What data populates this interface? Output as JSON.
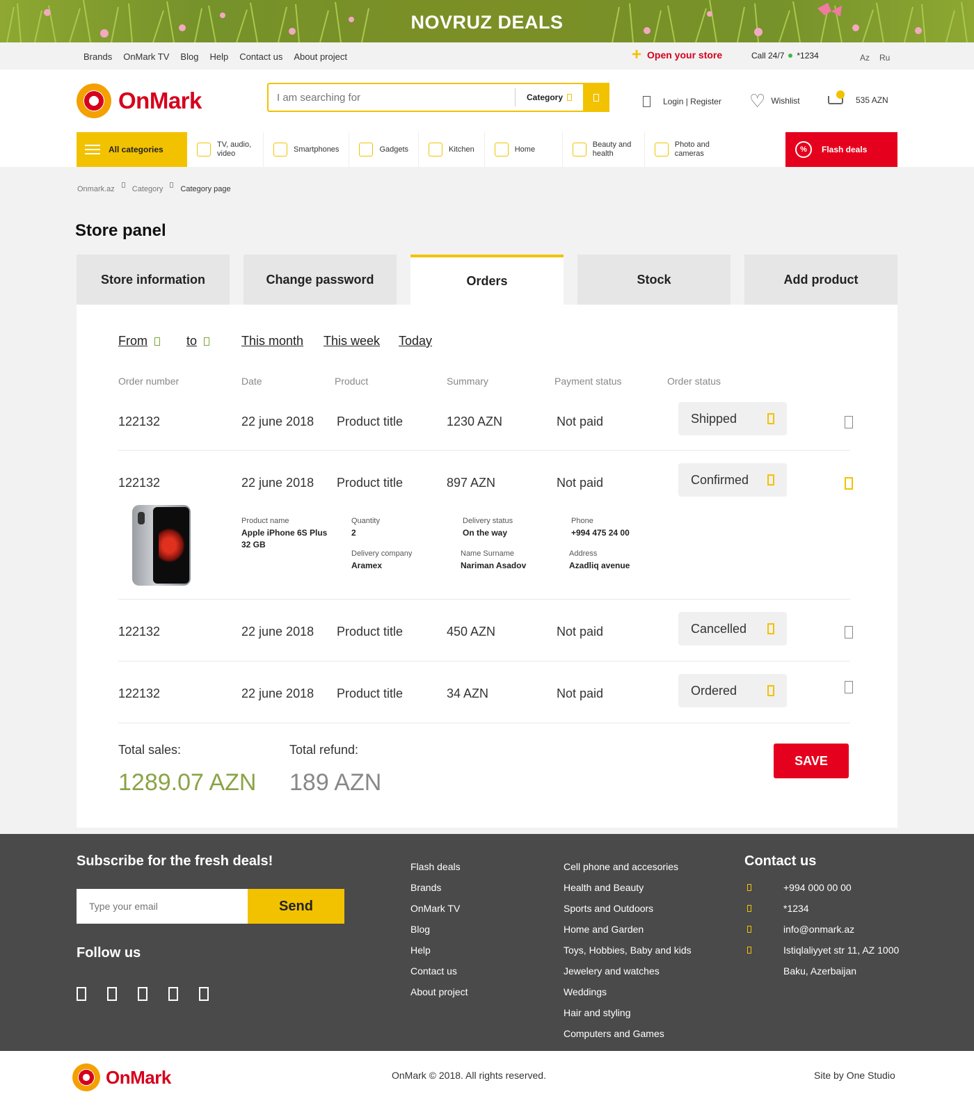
{
  "banner": {
    "title": "NOVRUZ DEALS"
  },
  "topbar": {
    "links": [
      "Brands",
      "OnMark TV",
      "Blog",
      "Help",
      "Contact us",
      "About project"
    ],
    "open_store": "Open your store",
    "call_label": "Call 24/7",
    "call_number": "*1234",
    "languages": [
      "Az",
      "Ru"
    ]
  },
  "header": {
    "logo": "OnMark",
    "search_placeholder": "I am searching for",
    "category_label": "Category",
    "login": "Login | Register",
    "wishlist": "Wishlist",
    "cart_total": "535 AZN"
  },
  "nav": {
    "all_categories": "All categories",
    "items": [
      "TV, audio, video",
      "Smartphones",
      "Gadgets",
      "Kitchen",
      "Home",
      "Beauty and health",
      "Photo and cameras"
    ],
    "flash_deals": "Flash deals",
    "flash_icon_text": "%"
  },
  "breadcrumb": [
    "Onmark.az",
    "Category",
    "Category page"
  ],
  "page_title": "Store panel",
  "tabs": [
    "Store information",
    "Change password",
    "Orders",
    "Stock",
    "Add product"
  ],
  "active_tab": "Orders",
  "filters": {
    "from": "From",
    "to": "to",
    "month": "This month",
    "week": "This week",
    "today": "Today"
  },
  "table": {
    "headers": [
      "Order number",
      "Date",
      "Product",
      "Summary",
      "Payment status",
      "Order status"
    ],
    "rows": [
      {
        "number": "122132",
        "date": "22 june 2018",
        "product": "Product title",
        "summary": "1230 AZN",
        "payment": "Not paid",
        "status": "Shipped",
        "expanded": false
      },
      {
        "number": "122132",
        "date": "22 june 2018",
        "product": "Product title",
        "summary": "897 AZN",
        "payment": "Not paid",
        "status": "Confirmed",
        "expanded": true
      },
      {
        "number": "122132",
        "date": "22 june 2018",
        "product": "Product title",
        "summary": "450 AZN",
        "payment": "Not paid",
        "status": "Cancelled",
        "expanded": false
      },
      {
        "number": "122132",
        "date": "22 june 2018",
        "product": "Product title",
        "summary": "34 AZN",
        "payment": "Not paid",
        "status": "Ordered",
        "expanded": false
      }
    ]
  },
  "details": {
    "product_name_label": "Product name",
    "product_name": "Apple iPhone 6S Plus 32 GB",
    "quantity_label": "Quantity",
    "quantity": "2",
    "delivery_status_label": "Delivery status",
    "delivery_status": "On the way",
    "phone_label": "Phone",
    "phone": "+994 475 24 00",
    "delivery_company_label": "Delivery company",
    "delivery_company": "Aramex",
    "name_label": "Name Surname",
    "name": "Nariman Asadov",
    "address_label": "Address",
    "address": "Azadliq avenue"
  },
  "totals": {
    "sales_label": "Total sales:",
    "sales": "1289.07 AZN",
    "refund_label": "Total refund:",
    "refund": "189 AZN",
    "save": "SAVE"
  },
  "footer": {
    "subscribe_title": "Subscribe for the fresh deals!",
    "email_placeholder": "Type your email",
    "send": "Send",
    "follow": "Follow us",
    "links1": [
      "Flash deals",
      "Brands",
      "OnMark TV",
      "Blog",
      "Help",
      "Contact us",
      "About project"
    ],
    "links2": [
      "Cell phone and accesories",
      "Health and Beauty",
      "Sports and Outdoors",
      "Home and Garden",
      "Toys, Hobbies, Baby and kids",
      "Jewelery and watches",
      "Weddings",
      "Hair and styling",
      "Computers and Games"
    ],
    "contact_title": "Contact us",
    "contacts": [
      "+994 000 00 00",
      "*1234",
      "info@onmark.az",
      "Istiqlaliyyet str 11, AZ 1000",
      "Baku, Azerbaijan"
    ]
  },
  "bottom": {
    "logo": "OnMark",
    "copyright": "OnMark © 2018. All rights reserved.",
    "site_by": "Site by One Studio"
  },
  "colors": {
    "accent_yellow": "#f2c200",
    "brand_red": "#e5001d",
    "sales_green": "#8aa347",
    "footer_bg": "#4a4a4a"
  }
}
